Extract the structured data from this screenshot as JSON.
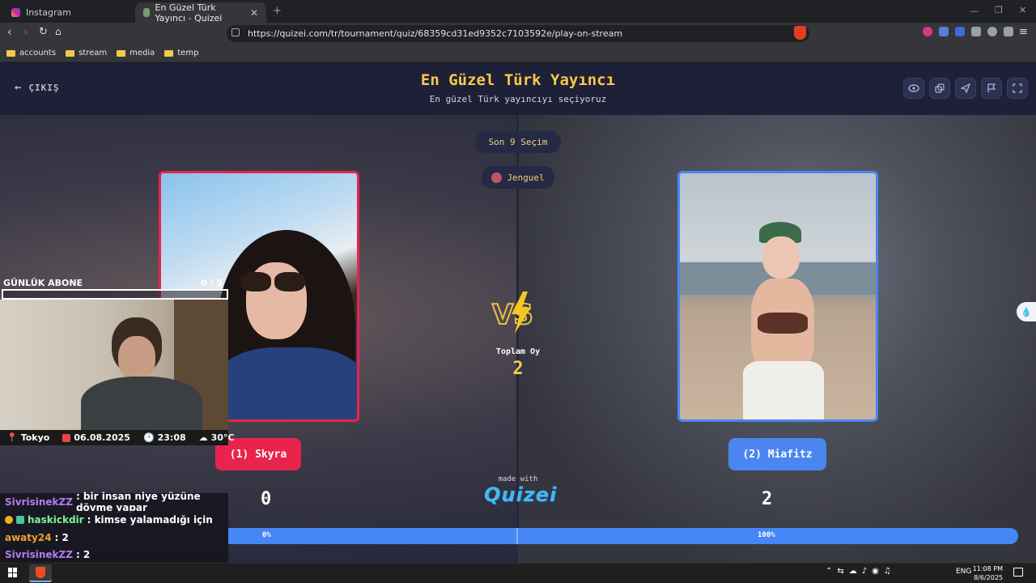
{
  "browser": {
    "tabs": [
      {
        "label": "Instagram",
        "active": false
      },
      {
        "label": "En Güzel Türk Yayıncı - Quizei",
        "active": true
      }
    ],
    "url": "https://quizei.com/tr/tournament/quiz/68359cd31ed9352c7103592e/play-on-stream",
    "bookmarks": [
      "accounts",
      "stream",
      "media",
      "temp"
    ]
  },
  "quiz": {
    "exit_label": "ÇIKIŞ",
    "title": "En Güzel Türk Yayıncı",
    "subtitle": "En güzel Türk yayıncıyı seçiyoruz",
    "round_label": "Son 9 Seçim",
    "creator": "Jenguel",
    "vs_label": "VS",
    "total_label": "Toplam Oy",
    "total_votes": "2",
    "left": {
      "button": "(1) Skyra",
      "score": "0",
      "percent": "0%"
    },
    "right": {
      "button": "(2) Miafitz",
      "score": "2",
      "percent": "100%"
    },
    "vote_share_right": 1.0,
    "made_with": "made with",
    "brand": "Quizei",
    "colors": {
      "accent": "#f7c948",
      "left": "#e8244d",
      "right": "#4a86f0"
    }
  },
  "overlay": {
    "abone_label": "GÜNLÜK ABONE",
    "abone_count": "0 / 5",
    "location": "Tokyo",
    "date": "06.08.2025",
    "time": "23:08",
    "temp": "30°C",
    "chat": [
      {
        "user": "SivrisinekZZ",
        "text": ": bir insan niye yüzüne dövme yapar",
        "color": "#b57cf0"
      },
      {
        "user": "haskickdir",
        "text": ": kimse yalamadığı için",
        "color": "#7ef29a"
      },
      {
        "user": "awaty24",
        "text": ": 2",
        "color": "#f0a030"
      },
      {
        "user": "SivrisinekZZ",
        "text": ": 2",
        "color": "#b57cf0"
      }
    ]
  },
  "taskbar": {
    "lang": "ENG",
    "time": "11:08 PM",
    "date": "8/6/2025"
  }
}
